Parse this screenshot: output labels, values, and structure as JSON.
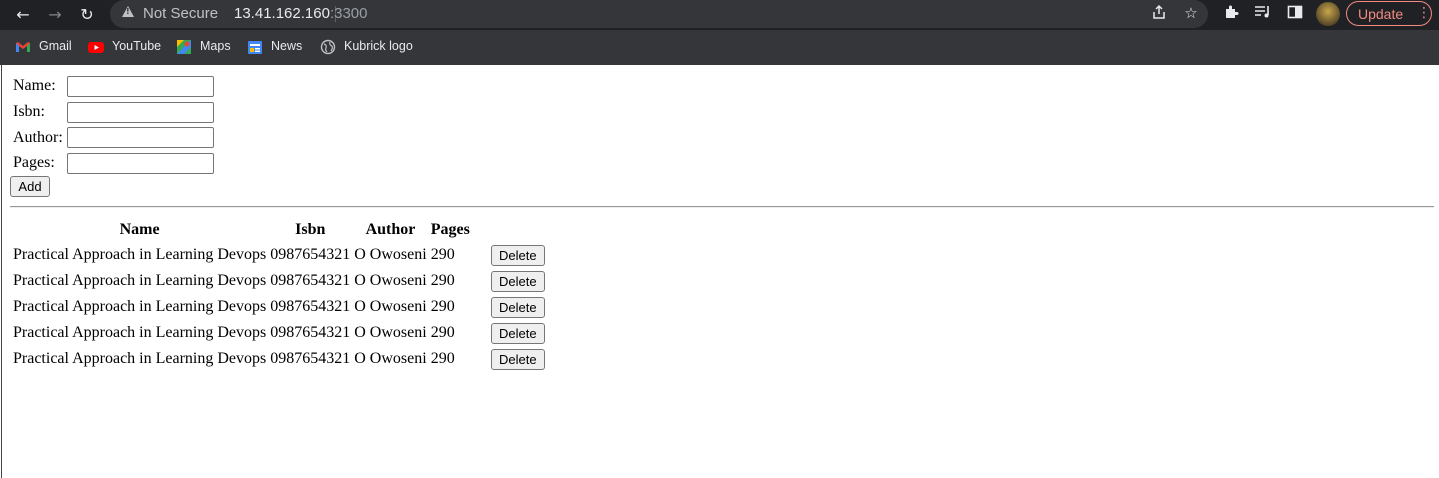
{
  "browser": {
    "url_host": "13.41.162.160",
    "url_port": ":3300",
    "security_label": "Not Secure",
    "update_label": "Update",
    "bookmarks": [
      {
        "label": "Gmail",
        "icon": "gmail-icon"
      },
      {
        "label": "YouTube",
        "icon": "youtube-icon"
      },
      {
        "label": "Maps",
        "icon": "maps-icon"
      },
      {
        "label": "News",
        "icon": "news-icon"
      },
      {
        "label": "Kubrick logo",
        "icon": "globe-icon"
      }
    ]
  },
  "form": {
    "name_label": "Name:",
    "isbn_label": "Isbn:",
    "author_label": "Author:",
    "pages_label": "Pages:",
    "name_value": "",
    "isbn_value": "",
    "author_value": "",
    "pages_value": "",
    "add_label": "Add"
  },
  "table": {
    "headers": [
      "Name",
      "Isbn",
      "Author",
      "Pages"
    ],
    "delete_label": "Delete",
    "rows": [
      {
        "name": "Practical Approach in Learning Devops",
        "isbn": "0987654321",
        "author": "O Owoseni",
        "pages": "290"
      },
      {
        "name": "Practical Approach in Learning Devops",
        "isbn": "0987654321",
        "author": "O Owoseni",
        "pages": "290"
      },
      {
        "name": "Practical Approach in Learning Devops",
        "isbn": "0987654321",
        "author": "O Owoseni",
        "pages": "290"
      },
      {
        "name": "Practical Approach in Learning Devops",
        "isbn": "0987654321",
        "author": "O Owoseni",
        "pages": "290"
      },
      {
        "name": "Practical Approach in Learning Devops",
        "isbn": "0987654321",
        "author": "O Owoseni",
        "pages": "290"
      }
    ]
  }
}
